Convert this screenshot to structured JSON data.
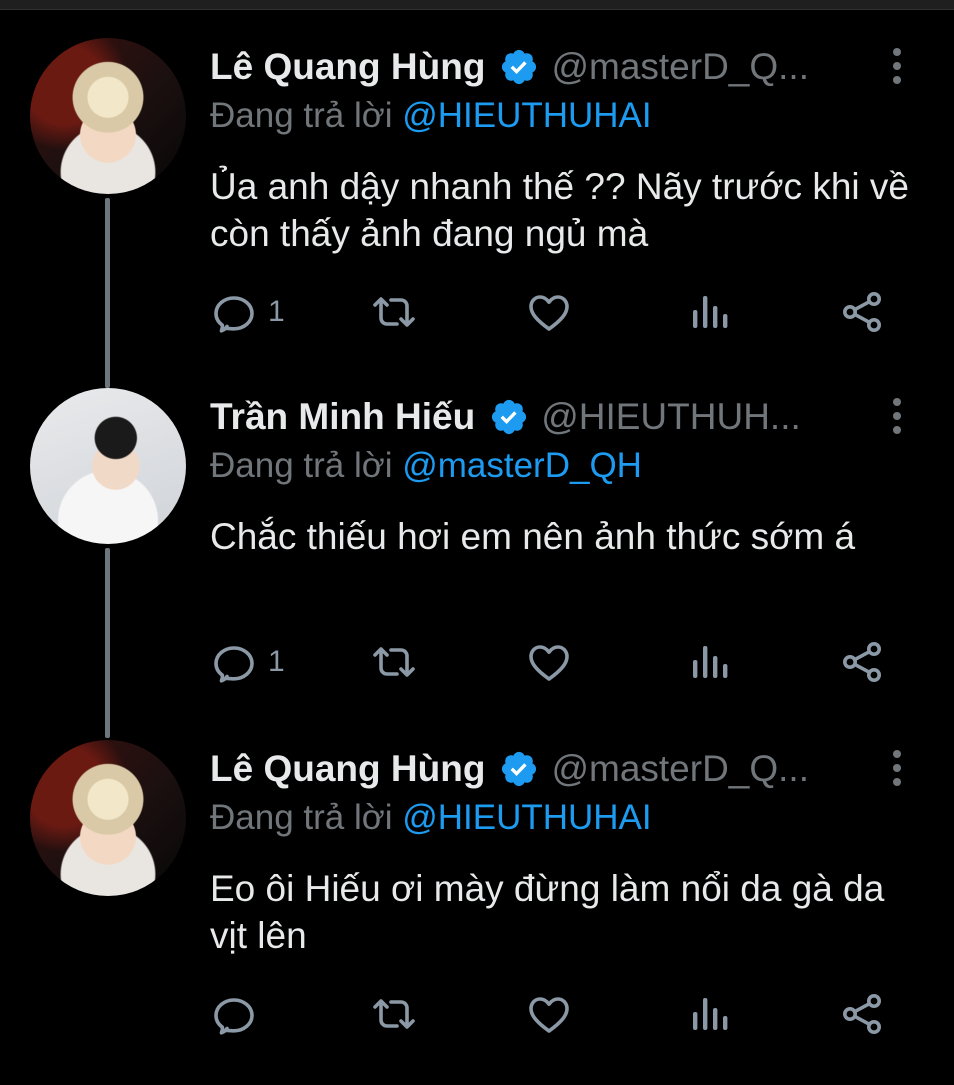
{
  "tweets": [
    {
      "name": "Lê Quang Hùng",
      "handle": "@masterD_Q...",
      "reply_prefix": "Đang trả lời",
      "reply_to": "@HIEUTHUHAI",
      "text": "Ủa anh dậy nhanh thế ?? Nãy trước khi về còn thấy ảnh đang ngủ mà",
      "reply_count": "1",
      "avatar": "le-quang-hung-photo"
    },
    {
      "name": "Trần Minh Hiếu",
      "handle": "@HIEUTHUH...",
      "reply_prefix": "Đang trả lời",
      "reply_to": "@masterD_QH",
      "text": "Chắc thiếu hơi em nên ảnh thức sớm á",
      "reply_count": "1",
      "avatar": "tran-minh-hieu-photo"
    },
    {
      "name": "Lê Quang Hùng",
      "handle": "@masterD_Q...",
      "reply_prefix": "Đang trả lời",
      "reply_to": "@HIEUTHUHAI",
      "text": "Eo ôi Hiếu ơi mày đừng làm nổi da gà da vịt lên",
      "reply_count": "",
      "avatar": "le-quang-hung-photo"
    }
  ],
  "icons": [
    "reply-icon",
    "retweet-icon",
    "like-icon",
    "views-icon",
    "share-icon",
    "verified-icon",
    "more-icon"
  ],
  "colors": {
    "background": "#000000",
    "text": "#e7e9ea",
    "muted": "#71767b",
    "accent": "#1d9bf0",
    "thread_line": "#6e767d"
  }
}
